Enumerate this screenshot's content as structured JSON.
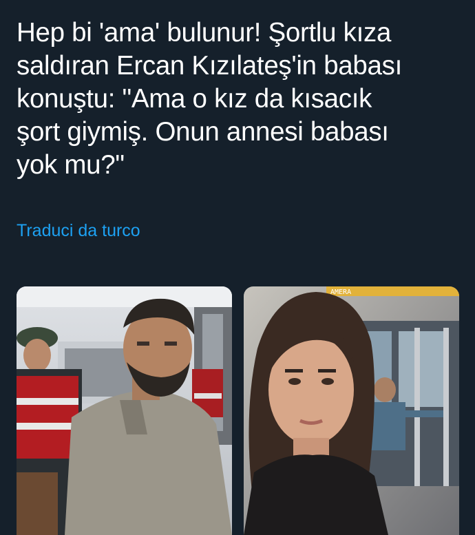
{
  "tweet": {
    "text_lines": [
      "Hep bi 'ama' bulunur! Şortlu kıza",
      "saldıran Ercan Kızılateş'in babası",
      "konuştu: \"Ama o kız da kısacık",
      "şort giymiş. Onun annesi babası",
      "yok mu?\""
    ],
    "translate_label": "Traduci da turco"
  },
  "media": {
    "left_photo": "Man with beard in grey shirt escorted by gendarmerie officer",
    "right_photo": {
      "overlay_text": "AMERA"
    }
  }
}
